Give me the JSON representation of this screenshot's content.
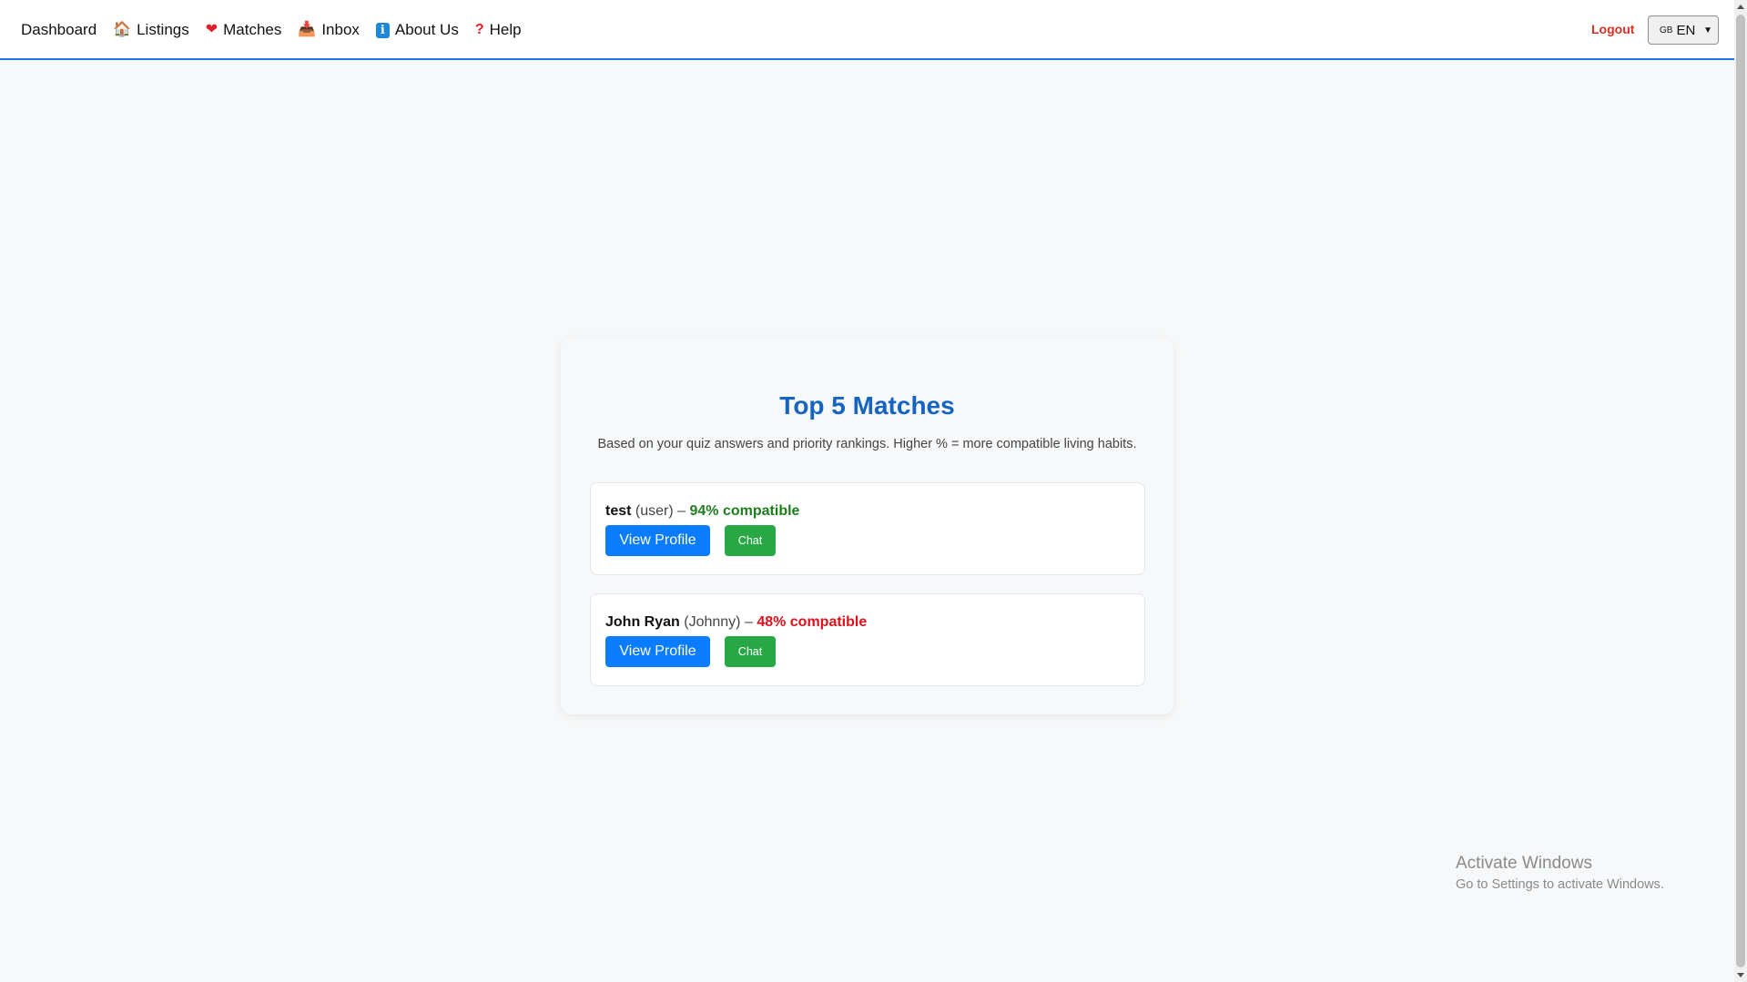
{
  "nav": {
    "items": [
      {
        "label": "Dashboard",
        "icon": ""
      },
      {
        "label": "Listings",
        "icon": "🏠"
      },
      {
        "label": "Matches",
        "icon": "❤"
      },
      {
        "label": "Inbox",
        "icon": "📥"
      },
      {
        "label": "About Us",
        "icon": "i"
      },
      {
        "label": "Help",
        "icon": "?"
      }
    ],
    "logout_label": "Logout",
    "language": {
      "flag": "GB",
      "selected": "EN"
    }
  },
  "page": {
    "title": "Top 5 Matches",
    "description": "Based on your quiz answers and priority rankings. Higher % = more compatible living habits."
  },
  "matches": [
    {
      "name": "test",
      "username": "(user)",
      "separator": "–",
      "compatibility": "94% compatible",
      "compatibility_value": 94,
      "compatibility_color": "#1e7e1e",
      "view_label": "View Profile",
      "chat_label": "Chat"
    },
    {
      "name": "John Ryan",
      "username": "(Johnny)",
      "separator": "–",
      "compatibility": "48% compatible",
      "compatibility_value": 48,
      "compatibility_color": "#e0101a",
      "view_label": "View Profile",
      "chat_label": "Chat"
    }
  ],
  "watermark": {
    "title": "Activate Windows",
    "subtitle": "Go to Settings to activate Windows."
  },
  "colors": {
    "accent": "#1a73e8",
    "title": "#1565c0",
    "primary_button": "#0a7cff",
    "chat_button": "#28a745",
    "logout": "#d93025"
  }
}
